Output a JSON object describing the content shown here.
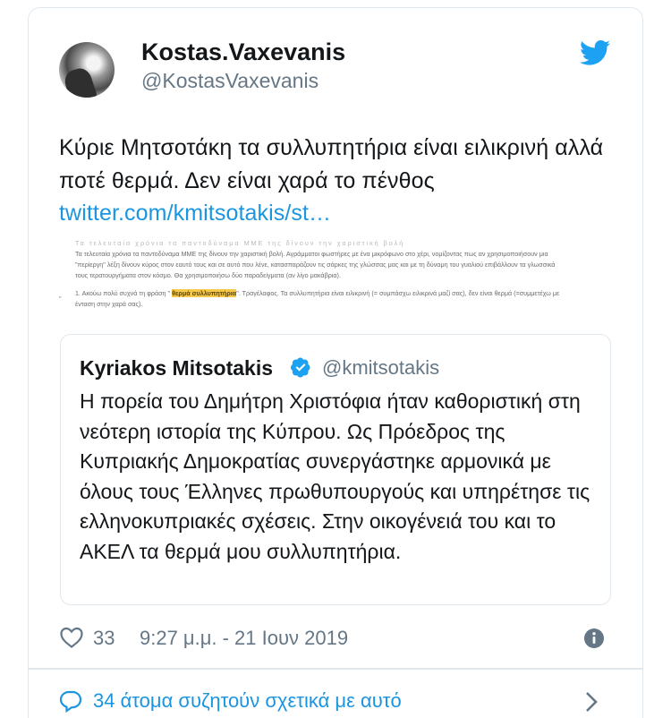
{
  "author": {
    "name": "Kostas.Vaxevanis",
    "handle": "@KostasVaxevanis"
  },
  "tweet": {
    "text": "Κύριε Μητσοτάκη τα συλλυπητήρια είναι ειλικρινή αλλά ποτέ θερμά. Δεν είναι χαρά το πένθος ",
    "link": "twitter.com/kmitsotakis/st…"
  },
  "image": {
    "line0": "Τα τελευταία χρόνια τα παντοδύναμα ΜΜΕ της δίνουν την χαριστική βολή",
    "line1": "Τα τελευταία χρόνια τα παντοδύναμα ΜΜΕ της δίνουν την χαριστική βολή. Αγράμματοι φωστήρες με ένα μικρόφωνο στο χέρι, νομίζοντας πως αν χρησιμοποιήσουν μια",
    "line2": "\"περίεργη\" λέξη δίνουν κύρος στον εαυτό τους και σε αυτό που λένε, κατασπαράζουν τις σάρκες της γλώσσας μας και με τη δύναμη του γυαλιού επιβάλλουν τα γλωσσικά",
    "line3": "τους τερατουργήματα στον κόσμο. Θα χρησιμοποιήσω δύο παραδείγματα (αν λίγο μακάβρια).",
    "line4_pre": "1. Ακούω πολύ συχνά τη φράση \" ",
    "line4_hl": "θερμά συλλυπητήρια",
    "line4_post": "\". Τραγέλαφος. Τα συλλυπητήρια είναι ειλικρινή (= συμπάσχω ειλικρινά μαζί σας), δεν είναι θερμά (=συμμετέχω με",
    "line5": "ένταση στην χαρά σας).",
    "tick": "\""
  },
  "quoted": {
    "name": "Kyriakos Mitsotakis",
    "handle": "@kmitsotakis",
    "text": "Η πορεία του Δημήτρη Χριστόφια ήταν καθοριστική στη νεότερη ιστορία της Κύπρου. Ως Πρόεδρος της Κυπριακής Δημοκρατίας συνεργάστηκε αρμονικά με όλους τους Έλληνες πρωθυπουργούς και υπηρέτησε τις ελληνοκυπριακές σχέσεις. Στην οικογένειά του και το ΑΚΕΛ τα θερμά μου συλλυπητήρια."
  },
  "meta": {
    "likes": "33",
    "timestamp": "9:27 μ.μ. - 21 Ιουν 2019"
  },
  "discussion": {
    "label": "34 άτομα συζητούν σχετικά με αυτό"
  },
  "icons": {
    "bird": "twitter-bird-icon",
    "verified": "verified-badge-icon",
    "heart": "heart-icon",
    "info": "info-icon",
    "bubble": "speech-bubble-icon",
    "chevron": "chevron-right-icon"
  },
  "colors": {
    "link": "#1b95e0",
    "brand": "#1da1f2",
    "muted": "#657786",
    "highlight": "#f7c94a"
  }
}
